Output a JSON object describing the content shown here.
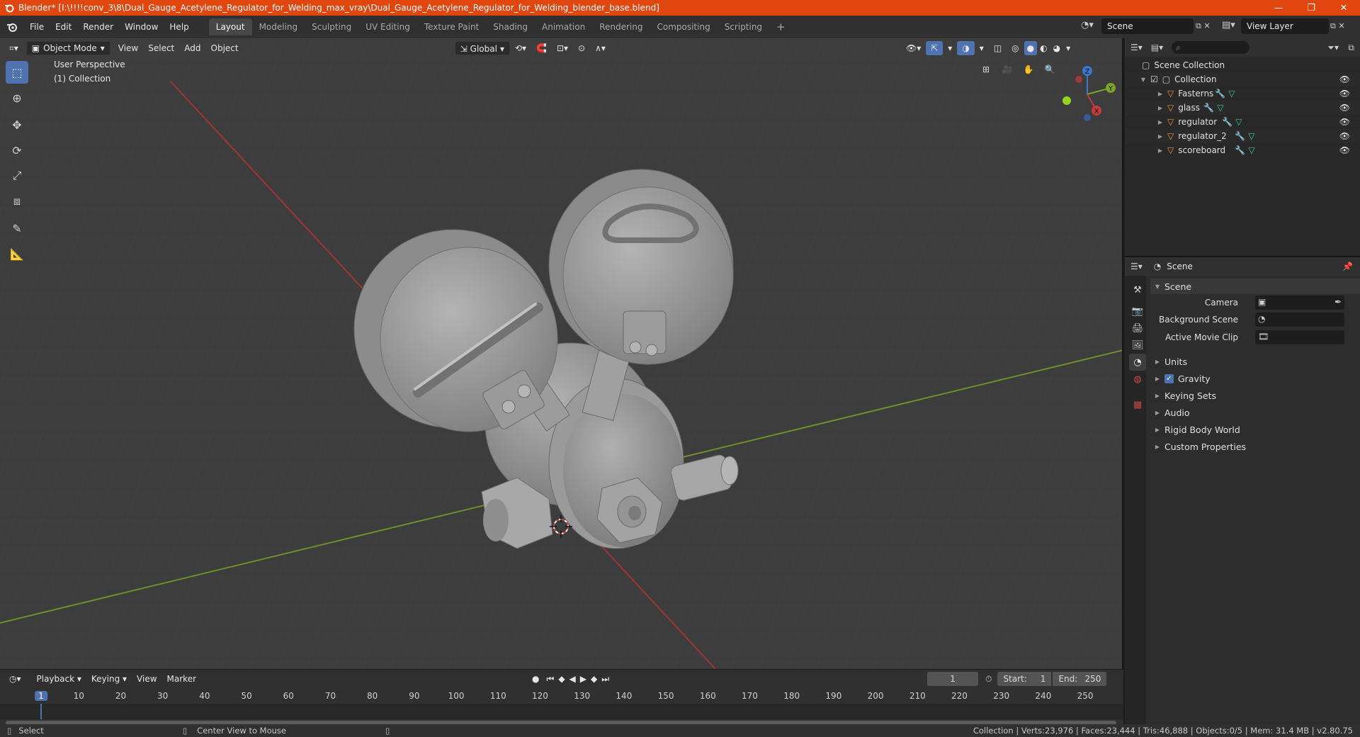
{
  "window": {
    "title": "Blender* [I:\\!!!!conv_3\\8\\Dual_Gauge_Acetylene_Regulator_for_Welding_max_vray\\Dual_Gauge_Acetylene_Regulator_for_Welding_blender_base.blend]",
    "minimize": "—",
    "maximize": "❐",
    "close": "✕"
  },
  "menubar": {
    "items": [
      "File",
      "Edit",
      "Render",
      "Window",
      "Help"
    ]
  },
  "workspaces": {
    "tabs": [
      "Layout",
      "Modeling",
      "Sculpting",
      "UV Editing",
      "Texture Paint",
      "Shading",
      "Animation",
      "Rendering",
      "Compositing",
      "Scripting"
    ],
    "add": "+",
    "active": "Layout"
  },
  "scene_selector": {
    "value": "Scene"
  },
  "view_layer_selector": {
    "value": "View Layer"
  },
  "viewport_header": {
    "mode": "Object Mode",
    "menus": [
      "View",
      "Select",
      "Add",
      "Object"
    ],
    "transform_orientation": "Global"
  },
  "viewport": {
    "perspective": "User Perspective",
    "collection": "(1) Collection",
    "gizmo": {
      "x": "X",
      "y": "Y",
      "z": "Z"
    }
  },
  "outliner": {
    "scene_collection": "Scene Collection",
    "collection": "Collection",
    "objects": [
      {
        "name": "Fasterns"
      },
      {
        "name": "glass"
      },
      {
        "name": "regulator"
      },
      {
        "name": "regulator_2"
      },
      {
        "name": "scoreboard"
      }
    ]
  },
  "properties": {
    "header": "Scene",
    "panel_scene": "Scene",
    "camera_label": "Camera",
    "background_scene_label": "Background Scene",
    "active_movie_clip_label": "Active Movie Clip",
    "panels": [
      "Units",
      "Gravity",
      "Keying Sets",
      "Audio",
      "Rigid Body World",
      "Custom Properties"
    ],
    "gravity_checked": true
  },
  "timeline": {
    "menus": [
      "Playback",
      "Keying",
      "View",
      "Marker"
    ],
    "current_frame": "1",
    "start_label": "Start:",
    "start_value": "1",
    "end_label": "End:",
    "end_value": "250",
    "ruler_labels": [
      "1",
      "10",
      "20",
      "30",
      "40",
      "50",
      "60",
      "70",
      "80",
      "90",
      "100",
      "110",
      "120",
      "130",
      "140",
      "150",
      "160",
      "170",
      "180",
      "190",
      "200",
      "210",
      "220",
      "230",
      "240",
      "250"
    ]
  },
  "statusbar": {
    "left_action": "Select",
    "middle_action": "Center View to Mouse",
    "stats": "Collection | Verts:23,976 | Faces:23,444 | Tris:46,888 | Objects:0/5 | Mem: 31.4 MB | v2.80.75"
  },
  "colors": {
    "titlebar": "#e2460f",
    "accent_blue": "#4f72b0",
    "x_axis": "#c83a3a",
    "y_axis": "#7aa52a",
    "z_axis": "#3a78c8",
    "object_orange": "#e8963a"
  }
}
